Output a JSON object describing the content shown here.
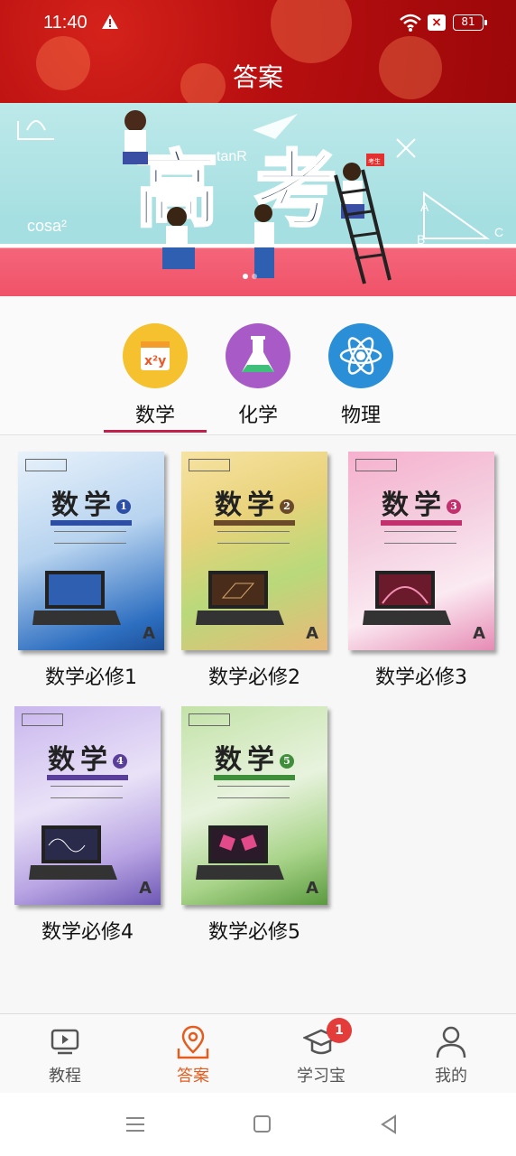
{
  "status_bar": {
    "time": "11:40",
    "battery": "81",
    "sim_icon": "sim-x-icon"
  },
  "header": {
    "title": "答案"
  },
  "banner": {
    "title": "高考",
    "sign_text": "考生",
    "doodles": [
      "tanR",
      "cosa²",
      "A",
      "B",
      "C"
    ]
  },
  "subjects": [
    {
      "label": "数学",
      "icon": "math-icon",
      "color": "#f5c12e",
      "selected": true
    },
    {
      "label": "化学",
      "icon": "flask-icon",
      "color": "#a85bc7",
      "selected": false
    },
    {
      "label": "物理",
      "icon": "atom-icon",
      "color": "#2a8fd6",
      "selected": false
    }
  ],
  "books": [
    {
      "name": "数学必修1",
      "cover_title": "数学",
      "cover_number": "1",
      "accent": "#2c4fa5"
    },
    {
      "name": "数学必修2",
      "cover_title": "数学",
      "cover_number": "2",
      "accent": "#6b4a2a"
    },
    {
      "name": "数学必修3",
      "cover_title": "数学",
      "cover_number": "3",
      "accent": "#c2306e"
    },
    {
      "name": "数学必修4",
      "cover_title": "数学",
      "cover_number": "4",
      "accent": "#5a3f9a"
    },
    {
      "name": "数学必修5",
      "cover_title": "数学",
      "cover_number": "5",
      "accent": "#3f8f3a"
    }
  ],
  "bottom_nav": [
    {
      "label": "教程",
      "icon": "video-icon",
      "active": false
    },
    {
      "label": "答案",
      "icon": "map-pin-icon",
      "active": true
    },
    {
      "label": "学习宝",
      "icon": "graduation-cap-icon",
      "active": false,
      "badge": "1"
    },
    {
      "label": "我的",
      "icon": "person-icon",
      "active": false
    }
  ],
  "colors": {
    "header_red": "#b80f10",
    "accent_orange": "#e45c1e",
    "tab_underline": "#c0204a"
  }
}
